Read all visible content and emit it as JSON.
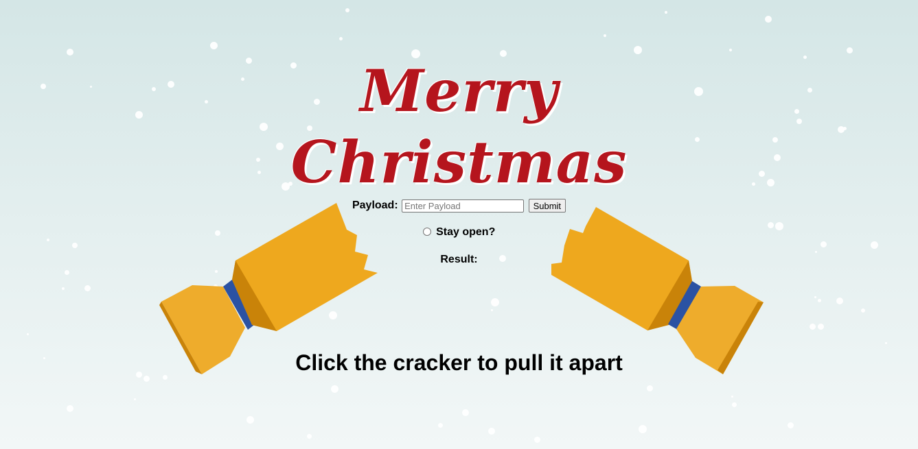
{
  "title": {
    "line1": "Merry",
    "line2": "Christmas",
    "color": "#b5151d"
  },
  "form": {
    "payload_label": "Payload:",
    "payload_placeholder": "Enter Payload",
    "payload_value": "",
    "submit_label": "Submit",
    "stay_open_label": "Stay open?",
    "stay_open_checked": false,
    "result_label": "Result:",
    "result_value": ""
  },
  "instruction": "Click the cracker to pull it apart",
  "cracker": {
    "body_color": "#eea81e",
    "shade_color": "#c98309",
    "band_color": "#2b52a3"
  },
  "background": {
    "top_color": "#d4e6e6",
    "bottom_color": "#f2f7f7",
    "snow_color": "#ffffff"
  }
}
